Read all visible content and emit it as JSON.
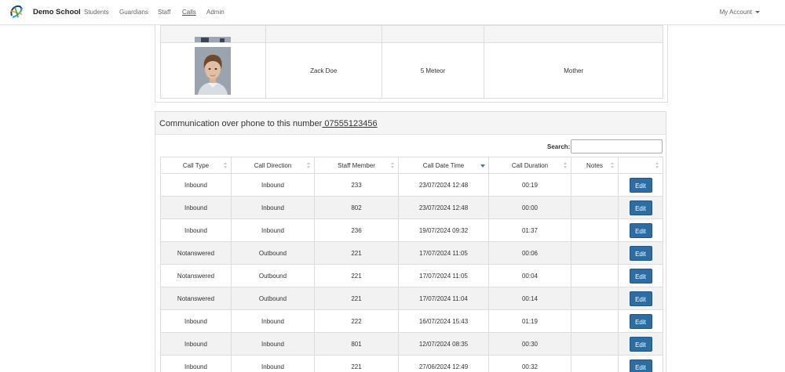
{
  "navbar": {
    "brand": "Demo School",
    "links": [
      "Students",
      "Guardians",
      "Staff",
      "Calls",
      "Admin"
    ],
    "active": "Calls",
    "account": "My Account"
  },
  "guardian": {
    "name": "Zack Doe",
    "address": "5 Meteor",
    "relationship": "Mother"
  },
  "communication": {
    "title_prefix": "Communication over phone to this number",
    "phone": " 07555123456",
    "search_label": "Search:",
    "search_value": "",
    "columns": [
      "Call Type",
      "Call Direction",
      "Staff Member",
      "Call Date Time",
      "Call Duration",
      "Notes",
      ""
    ],
    "sorted_column": "Call Date Time",
    "sort_direction": "desc",
    "edit_label": "Edit",
    "rows": [
      {
        "type": "Inbound",
        "direction": "Inbound",
        "staff": "233",
        "datetime": "23/07/2024 12:48",
        "duration": "00:19",
        "notes": ""
      },
      {
        "type": "Inbound",
        "direction": "Inbound",
        "staff": "802",
        "datetime": "23/07/2024 12:48",
        "duration": "00:00",
        "notes": ""
      },
      {
        "type": "Inbound",
        "direction": "Inbound",
        "staff": "236",
        "datetime": "19/07/2024 09:32",
        "duration": "01:37",
        "notes": ""
      },
      {
        "type": "Notanswered",
        "direction": "Outbound",
        "staff": "221",
        "datetime": "17/07/2024 11:05",
        "duration": "00:06",
        "notes": ""
      },
      {
        "type": "Notanswered",
        "direction": "Outbound",
        "staff": "221",
        "datetime": "17/07/2024 11:05",
        "duration": "00:04",
        "notes": ""
      },
      {
        "type": "Notanswered",
        "direction": "Outbound",
        "staff": "221",
        "datetime": "17/07/2024 11:04",
        "duration": "00:14",
        "notes": ""
      },
      {
        "type": "Inbound",
        "direction": "Inbound",
        "staff": "222",
        "datetime": "16/07/2024 15:43",
        "duration": "01:19",
        "notes": ""
      },
      {
        "type": "Inbound",
        "direction": "Inbound",
        "staff": "801",
        "datetime": "12/07/2024 08:35",
        "duration": "00:30",
        "notes": ""
      },
      {
        "type": "Inbound",
        "direction": "Inbound",
        "staff": "221",
        "datetime": "27/06/2024 12:49",
        "duration": "00:32",
        "notes": ""
      }
    ]
  },
  "icons": {
    "logo": "school-logo-icon",
    "sort": "sort-icon",
    "sort_desc": "sort-desc-icon",
    "caret": "caret-down-icon"
  },
  "colors": {
    "button": "#2e6da4",
    "stripe": "#f2f2f2",
    "sort_active": "#5470a8"
  }
}
